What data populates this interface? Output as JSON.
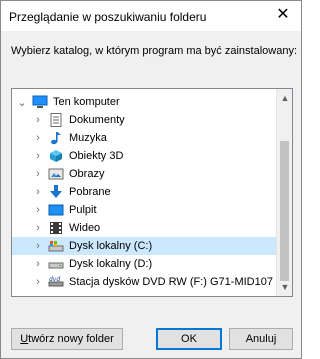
{
  "window": {
    "title": "Przeglądanie w poszukiwaniu folderu",
    "close_glyph": "✕"
  },
  "instruction": "Wybierz katalog, w którym program ma być zainstalowany:",
  "tree": {
    "items": [
      {
        "label": "Ten komputer",
        "icon": "computer-icon",
        "expanded": true,
        "level": 0
      },
      {
        "label": "Dokumenty",
        "icon": "documents-icon",
        "level": 1
      },
      {
        "label": "Muzyka",
        "icon": "music-icon",
        "level": 1
      },
      {
        "label": "Obiekty 3D",
        "icon": "objects-3d-icon",
        "level": 1
      },
      {
        "label": "Obrazy",
        "icon": "pictures-icon",
        "level": 1
      },
      {
        "label": "Pobrane",
        "icon": "downloads-icon",
        "level": 1
      },
      {
        "label": "Pulpit",
        "icon": "desktop-icon",
        "level": 1
      },
      {
        "label": "Wideo",
        "icon": "videos-icon",
        "level": 1
      },
      {
        "label": "Dysk lokalny (C:)",
        "icon": "local-disk-icon",
        "level": 1,
        "selected": true
      },
      {
        "label": "Dysk lokalny (D:)",
        "icon": "local-disk-icon",
        "level": 1
      },
      {
        "label": "Stacja dysków DVD RW (F:) G71-MID107",
        "icon": "dvd-drive-icon",
        "level": 1
      }
    ]
  },
  "buttons": {
    "new_folder_prefix": "U",
    "new_folder_rest": "twórz nowy folder",
    "ok": "OK",
    "cancel": "Anuluj"
  },
  "colors": {
    "selection": "#cce8ff",
    "accent": "#0078d7"
  }
}
